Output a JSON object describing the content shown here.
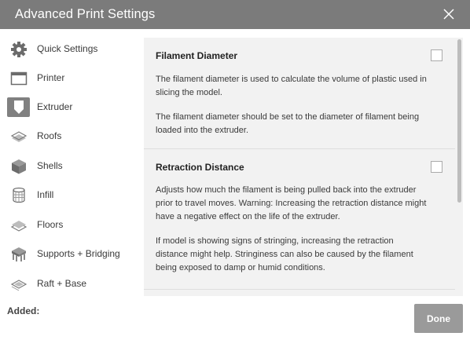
{
  "window": {
    "title": "Advanced Print Settings"
  },
  "sidebar": {
    "items": [
      {
        "label": "Quick Settings",
        "icon": "gear-icon",
        "active": false
      },
      {
        "label": "Printer",
        "icon": "printer-window-icon",
        "active": false
      },
      {
        "label": "Extruder",
        "icon": "extruder-icon",
        "active": true
      },
      {
        "label": "Roofs",
        "icon": "roofs-layers-icon",
        "active": false
      },
      {
        "label": "Shells",
        "icon": "shells-cube-icon",
        "active": false
      },
      {
        "label": "Infill",
        "icon": "infill-cylinder-icon",
        "active": false
      },
      {
        "label": "Floors",
        "icon": "floors-layers-icon",
        "active": false
      },
      {
        "label": "Supports + Bridging",
        "icon": "supports-icon",
        "active": false
      },
      {
        "label": "Raft + Base",
        "icon": "raft-base-icon",
        "active": false
      }
    ]
  },
  "settings": [
    {
      "title": "Filament Diameter",
      "checked": false,
      "paragraphs": [
        "The filament diameter is used to calculate the volume of plastic used in slicing the model.",
        "The filament diameter should be set to the diameter of filament being loaded into the extruder."
      ]
    },
    {
      "title": "Retraction Distance",
      "checked": false,
      "paragraphs": [
        "Adjusts how much the filament is being pulled back into the extruder prior to travel moves. Warning: Increasing the retraction distance might have a negative effect on the life of the extruder.",
        "If model is showing signs of stringing, increasing the retraction distance might help. Stringiness can also be caused by the filament being exposed to damp or humid conditions."
      ]
    }
  ],
  "footer": {
    "added_label": "Added:",
    "done_label": "Done"
  },
  "colors": {
    "titlebar": "#7b7b7b",
    "panel": "#f2f2f2",
    "active_icon_bg": "#808080",
    "done_button": "#9a9a9a"
  }
}
